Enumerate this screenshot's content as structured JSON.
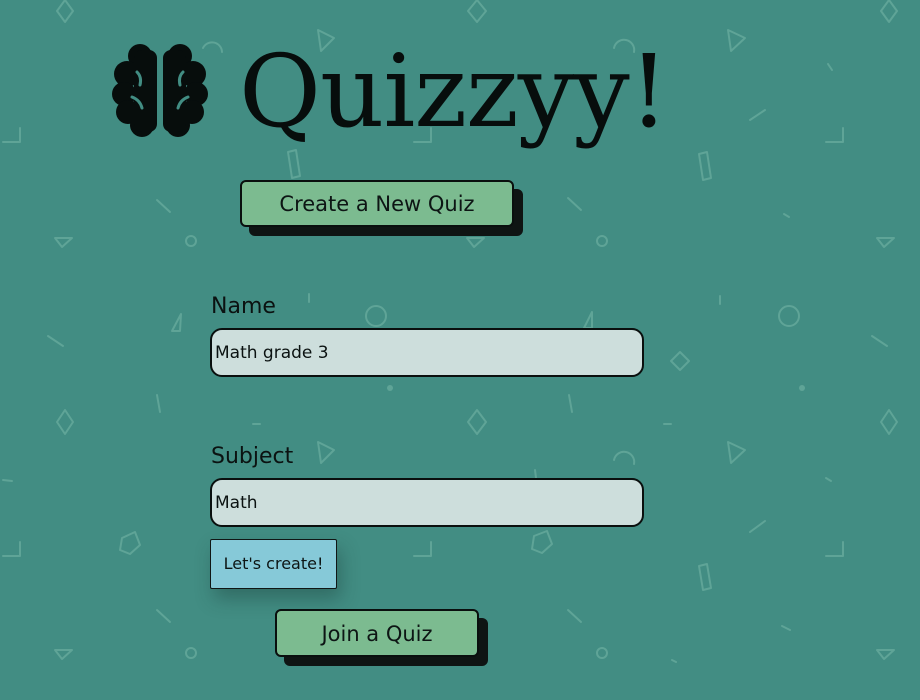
{
  "app": {
    "title": "Quizzyy!",
    "logo_icon": "brain-icon"
  },
  "buttons": {
    "create_quiz": "Create a New Quiz",
    "lets_create": "Let's create!",
    "join_quiz": "Join a Quiz"
  },
  "form": {
    "name": {
      "label": "Name",
      "value": "Math grade 3"
    },
    "subject": {
      "label": "Subject",
      "value": "Math"
    }
  },
  "colors": {
    "background": "#428d83",
    "button_green": "#7cbb90",
    "button_blue": "#86c9d8",
    "input_fill": "#cddedc",
    "ink": "#0a0f0e"
  }
}
